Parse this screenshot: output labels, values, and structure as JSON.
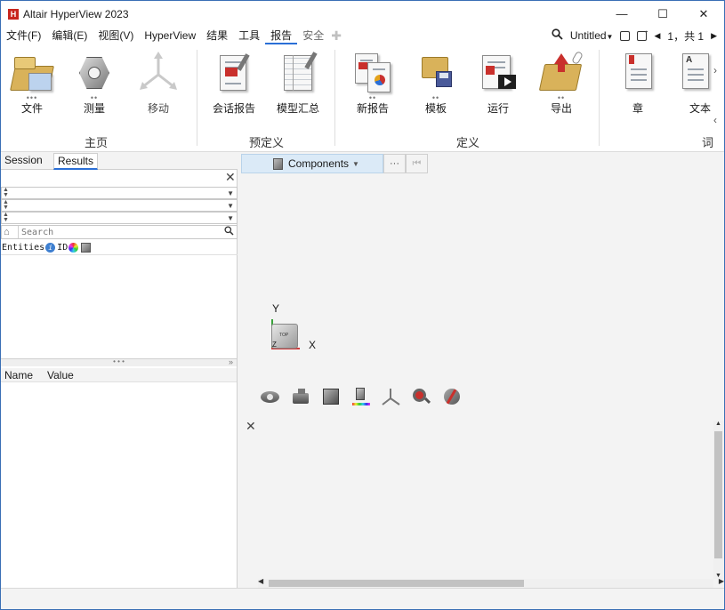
{
  "window": {
    "title": "Altair HyperView 2023",
    "logo_text": "H",
    "controls": {
      "minimize": "—",
      "maximize": "☐",
      "close": "✕"
    }
  },
  "menu": {
    "items": [
      "文件(F)",
      "编辑(E)",
      "视图(V)",
      "HyperView",
      "结果",
      "工具",
      "报告",
      "安全"
    ],
    "active_index": 6,
    "right": {
      "document_name": "Untitled",
      "page_indicator": "1，共 1"
    }
  },
  "ribbon": {
    "tools": {
      "file": "文件",
      "measure": "测量",
      "move": "移动",
      "session_report": "会话报告",
      "model_summary": "模型汇总",
      "new_report": "新报告",
      "template": "模板",
      "run": "运行",
      "export": "导出",
      "chapter": "章",
      "text": "文本"
    },
    "groups": {
      "home": "主页",
      "predefined": "预定义",
      "define": "定义",
      "partial": "词"
    }
  },
  "left_panel": {
    "tabs": [
      "Session",
      "Results"
    ],
    "active_tab": "Results",
    "search_placeholder": "Search",
    "entities_label": "Entities",
    "id_label": "ID",
    "properties_columns": [
      "Name",
      "Value"
    ]
  },
  "graphics": {
    "entity_selector": "Components",
    "more_button": "···",
    "axis_y": "Y",
    "axis_x": "X",
    "axis_z": "Z",
    "view_cube_face": "TOP"
  },
  "colors": {
    "accent": "#2a6fd6",
    "selector_bg": "#dbeaf7",
    "brand_red": "#c8261e"
  }
}
